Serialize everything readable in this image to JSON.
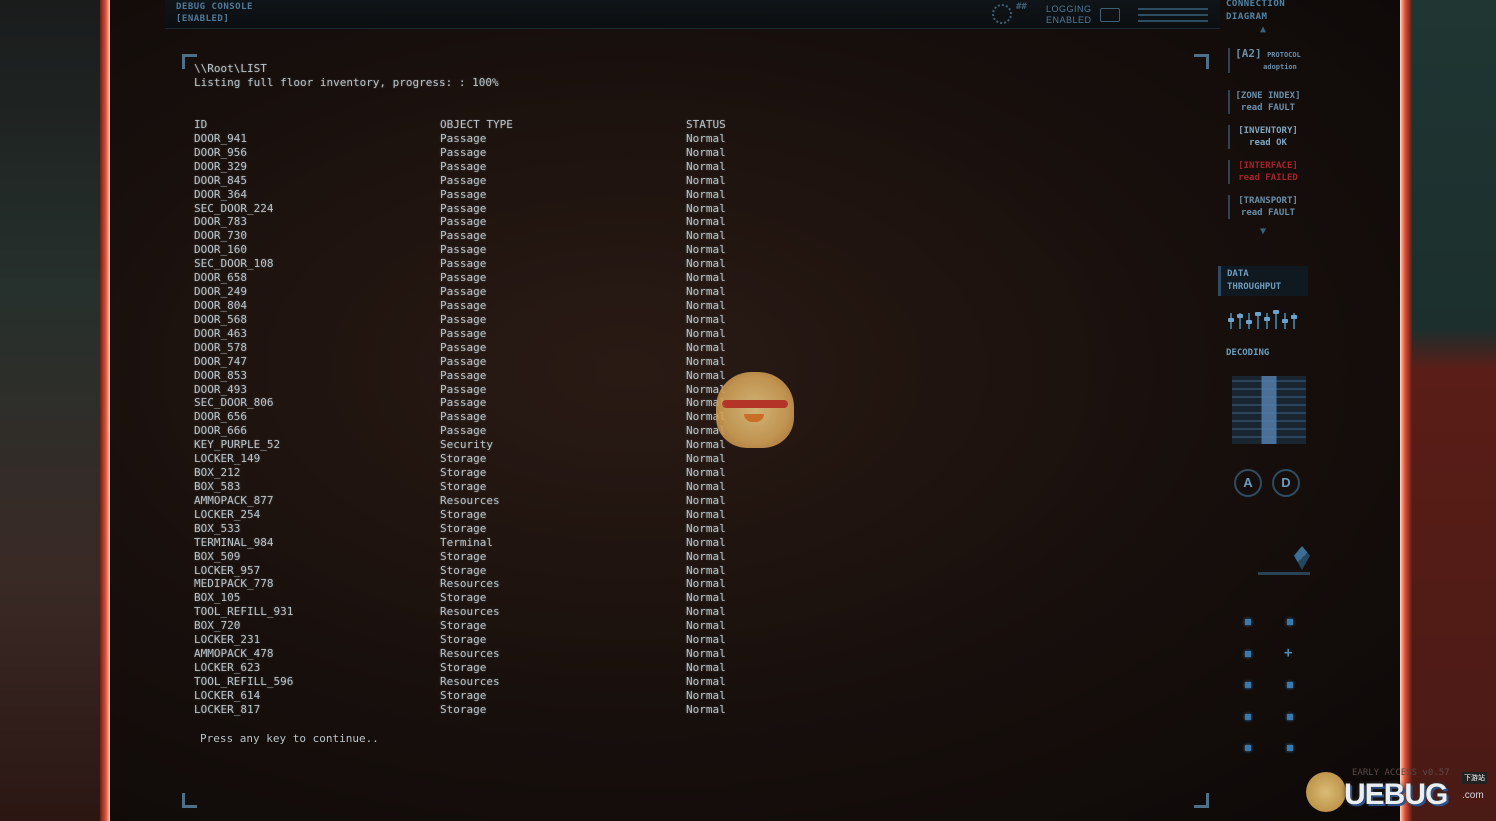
{
  "topbar": {
    "debug_line1": "DEBUG CONSOLE",
    "debug_line2": "[ENABLED]",
    "logging_line1": "LOGGING",
    "logging_line2": "ENABLED"
  },
  "terminal": {
    "path": "\\\\Root\\LIST",
    "progress": "Listing full floor inventory, progress: : 100%",
    "headers": [
      "ID",
      "OBJECT TYPE",
      "STATUS"
    ],
    "rows": [
      [
        "DOOR_941",
        "Passage",
        "Normal"
      ],
      [
        "DOOR_956",
        "Passage",
        "Normal"
      ],
      [
        "DOOR_329",
        "Passage",
        "Normal"
      ],
      [
        "DOOR_845",
        "Passage",
        "Normal"
      ],
      [
        "DOOR_364",
        "Passage",
        "Normal"
      ],
      [
        "SEC_DOOR_224",
        "Passage",
        "Normal"
      ],
      [
        "DOOR_783",
        "Passage",
        "Normal"
      ],
      [
        "DOOR_730",
        "Passage",
        "Normal"
      ],
      [
        "DOOR_160",
        "Passage",
        "Normal"
      ],
      [
        "SEC_DOOR_108",
        "Passage",
        "Normal"
      ],
      [
        "DOOR_658",
        "Passage",
        "Normal"
      ],
      [
        "DOOR_249",
        "Passage",
        "Normal"
      ],
      [
        "DOOR_804",
        "Passage",
        "Normal"
      ],
      [
        "DOOR_568",
        "Passage",
        "Normal"
      ],
      [
        "DOOR_463",
        "Passage",
        "Normal"
      ],
      [
        "DOOR_578",
        "Passage",
        "Normal"
      ],
      [
        "DOOR_747",
        "Passage",
        "Normal"
      ],
      [
        "DOOR_853",
        "Passage",
        "Normal"
      ],
      [
        "DOOR_493",
        "Passage",
        "Normal"
      ],
      [
        "SEC_DOOR_806",
        "Passage",
        "Normal"
      ],
      [
        "DOOR_656",
        "Passage",
        "Normal"
      ],
      [
        "DOOR_666",
        "Passage",
        "Normal"
      ],
      [
        "KEY_PURPLE_52",
        "Security",
        "Normal"
      ],
      [
        "LOCKER_149",
        "Storage",
        "Normal"
      ],
      [
        "BOX_212",
        "Storage",
        "Normal"
      ],
      [
        "BOX_583",
        "Storage",
        "Normal"
      ],
      [
        "AMMOPACK_877",
        "Resources",
        "Normal"
      ],
      [
        "LOCKER_254",
        "Storage",
        "Normal"
      ],
      [
        "BOX_533",
        "Storage",
        "Normal"
      ],
      [
        "TERMINAL_984",
        "Terminal",
        "Normal"
      ],
      [
        "BOX_509",
        "Storage",
        "Normal"
      ],
      [
        "LOCKER_957",
        "Storage",
        "Normal"
      ],
      [
        "MEDIPACK_778",
        "Resources",
        "Normal"
      ],
      [
        "BOX_105",
        "Storage",
        "Normal"
      ],
      [
        "TOOL_REFILL_931",
        "Resources",
        "Normal"
      ],
      [
        "BOX_720",
        "Storage",
        "Normal"
      ],
      [
        "LOCKER_231",
        "Storage",
        "Normal"
      ],
      [
        "AMMOPACK_478",
        "Resources",
        "Normal"
      ],
      [
        "LOCKER_623",
        "Storage",
        "Normal"
      ],
      [
        "TOOL_REFILL_596",
        "Resources",
        "Normal"
      ],
      [
        "LOCKER_614",
        "Storage",
        "Normal"
      ],
      [
        "LOCKER_817",
        "Storage",
        "Normal"
      ]
    ],
    "prompt": "Press any key to continue.."
  },
  "side_panel": {
    "title_line1": "CONNECTION",
    "title_line2": "DIAGRAM",
    "items": [
      {
        "label": "[A2]",
        "sub1": "PROTOCOL",
        "sub2": "adoption"
      },
      {
        "label": "[ZONE INDEX]",
        "sub": "read FAULT"
      },
      {
        "label": "[INVENTORY]",
        "sub": "read OK"
      },
      {
        "label": "[INTERFACE]",
        "sub": "read FAILED"
      },
      {
        "label": "[TRANSPORT]",
        "sub": "read FAULT"
      }
    ],
    "throughput_line1": "DATA",
    "throughput_line2": "THROUGHPUT",
    "decoding": "DECODING",
    "button_a": "A",
    "button_d": "D"
  },
  "watermark": {
    "brand": "UEBUG",
    "tag": "下游站",
    "sub": ".com",
    "faint_line": "EARLY ACCESS v0.57"
  },
  "colors": {
    "terminal_text": "#b9c3c8",
    "accent": "#4f86aa",
    "fail": "#a6232a"
  }
}
